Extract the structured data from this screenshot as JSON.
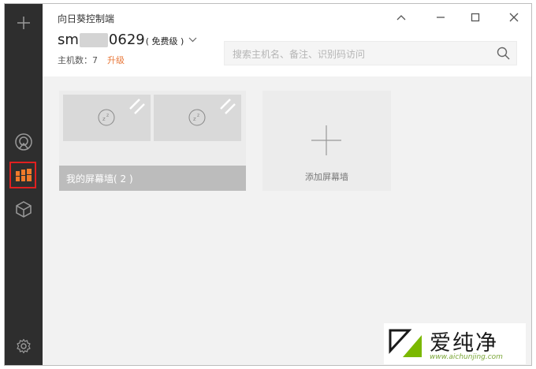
{
  "app": {
    "title": "向日葵控制端"
  },
  "sidebar": {
    "items": [
      {
        "icon": "plus-icon"
      },
      {
        "icon": "remote-icon"
      },
      {
        "icon": "screen-wall-icon",
        "active": true
      },
      {
        "icon": "cube-icon"
      },
      {
        "icon": "gear-icon"
      }
    ],
    "active_color": "#e02020"
  },
  "account": {
    "name_prefix": "sm",
    "name_suffix": "0629",
    "plan": "( 免费级 )",
    "host_count": "主机数：7",
    "upgrade": "升级"
  },
  "search": {
    "placeholder": "搜索主机名、备注、识别码访问",
    "value": ""
  },
  "walls": [
    {
      "label": "我的屏幕墙( 2 )"
    }
  ],
  "add_wall": {
    "label": "添加屏幕墙"
  },
  "watermark": {
    "text": "爱纯净",
    "url": "www.aichunjing.com",
    "accent": "#7ab800"
  },
  "colors": {
    "sidebar": "#2e2e2e",
    "upgrade": "#e8783a"
  }
}
